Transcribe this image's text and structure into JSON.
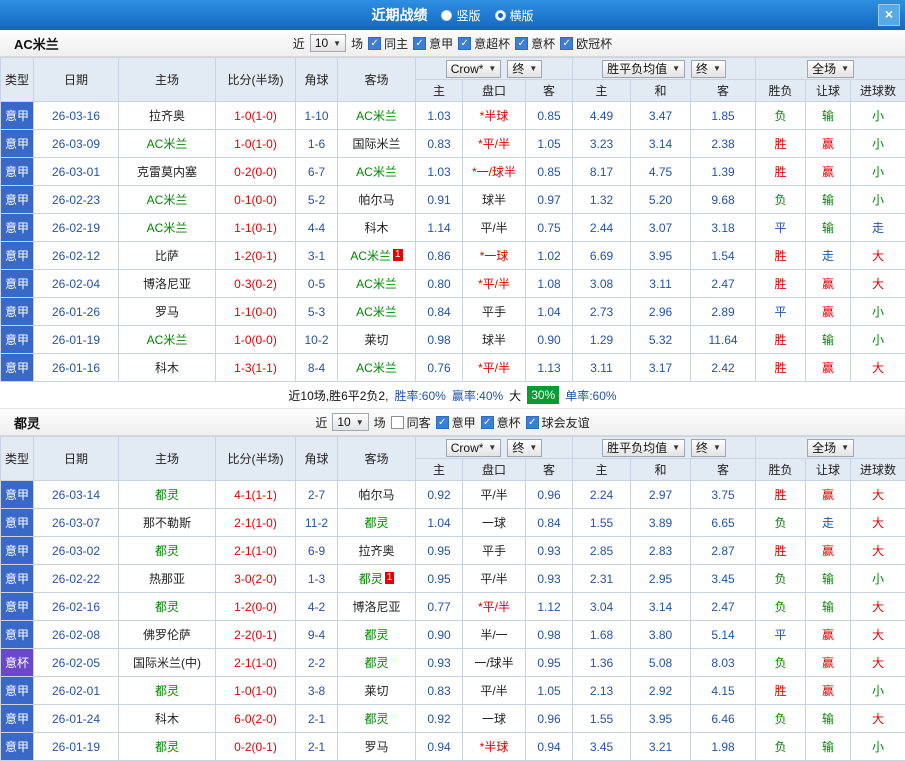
{
  "topbar": {
    "title": "近期战绩",
    "radios": [
      {
        "label": "竖版",
        "selected": false
      },
      {
        "label": "横版",
        "selected": true
      }
    ],
    "close_label": "×"
  },
  "colors": {
    "topbar_blue": "#1268C0",
    "league_type_bg": "#3A68C6",
    "cup_type_bg": "#6A48C8",
    "win_red": "#E60000",
    "lose_green": "#008800",
    "push_blue": "#2353A8",
    "rate_badge_green": "#0B9B33"
  },
  "table_header": {
    "type": "类型",
    "date": "日期",
    "home": "主场",
    "score": "比分(半场)",
    "corner": "角球",
    "away": "客场",
    "bookmaker_dd": "Crow*",
    "final_dd": "终",
    "asia_home": "主",
    "handicap": "盘口",
    "asia_away": "客",
    "eu_dd": "胜平负均值",
    "eu_final_dd": "终",
    "eu_home": "主",
    "eu_draw": "和",
    "eu_away": "客",
    "scope_dd": "全场",
    "result": "胜负",
    "handicap_result": "让球",
    "goals": "进球数"
  },
  "sections": [
    {
      "team": "AC米兰",
      "near_label": "近",
      "near_count": "10",
      "games_label": "场",
      "checkboxes": [
        {
          "label": "同主",
          "checked": true
        },
        {
          "label": "意甲",
          "checked": true
        },
        {
          "label": "意超杯",
          "checked": true
        },
        {
          "label": "意杯",
          "checked": true
        },
        {
          "label": "欧冠杯",
          "checked": true
        }
      ],
      "rows": [
        {
          "type": "意甲",
          "date": "26-03-16",
          "home": "拉齐奥",
          "score": "1-0(1-0)",
          "corner": "1-10",
          "away": "AC米兰",
          "asia_home": "1.03",
          "handicap": "*半球",
          "asia_away": "0.85",
          "eu_home": "4.49",
          "eu_draw": "3.47",
          "eu_away": "1.85",
          "result": "负",
          "handicap_result": "输",
          "goals": "小"
        },
        {
          "type": "意甲",
          "date": "26-03-09",
          "home": "AC米兰",
          "score": "1-0(1-0)",
          "corner": "1-6",
          "away": "国际米兰",
          "asia_home": "0.83",
          "handicap": "*平/半",
          "asia_away": "1.05",
          "eu_home": "3.23",
          "eu_draw": "3.14",
          "eu_away": "2.38",
          "result": "胜",
          "handicap_result": "赢",
          "goals": "小"
        },
        {
          "type": "意甲",
          "date": "26-03-01",
          "home": "克雷莫内塞",
          "score": "0-2(0-0)",
          "corner": "6-7",
          "away": "AC米兰",
          "asia_home": "1.03",
          "handicap": "*一/球半",
          "asia_away": "0.85",
          "eu_home": "8.17",
          "eu_draw": "4.75",
          "eu_away": "1.39",
          "result": "胜",
          "handicap_result": "赢",
          "goals": "小"
        },
        {
          "type": "意甲",
          "date": "26-02-23",
          "home": "AC米兰",
          "score": "0-1(0-0)",
          "corner": "5-2",
          "away": "帕尔马",
          "asia_home": "0.91",
          "handicap": "球半",
          "asia_away": "0.97",
          "eu_home": "1.32",
          "eu_draw": "5.20",
          "eu_away": "9.68",
          "result": "负",
          "handicap_result": "输",
          "goals": "小"
        },
        {
          "type": "意甲",
          "date": "26-02-19",
          "home": "AC米兰",
          "score": "1-1(0-1)",
          "corner": "4-4",
          "away": "科木",
          "asia_home": "1.14",
          "handicap": "平/半",
          "asia_away": "0.75",
          "eu_home": "2.44",
          "eu_draw": "3.07",
          "eu_away": "3.18",
          "result": "平",
          "handicap_result": "输",
          "goals": "走"
        },
        {
          "type": "意甲",
          "date": "26-02-12",
          "home": "比萨",
          "score": "1-2(0-1)",
          "corner": "3-1",
          "away": "AC米兰",
          "away_badge": "1",
          "asia_home": "0.86",
          "handicap": "*一球",
          "asia_away": "1.02",
          "eu_home": "6.69",
          "eu_draw": "3.95",
          "eu_away": "1.54",
          "result": "胜",
          "handicap_result": "走",
          "goals": "大"
        },
        {
          "type": "意甲",
          "date": "26-02-04",
          "home": "博洛尼亚",
          "score": "0-3(0-2)",
          "corner": "0-5",
          "away": "AC米兰",
          "asia_home": "0.80",
          "handicap": "*平/半",
          "asia_away": "1.08",
          "eu_home": "3.08",
          "eu_draw": "3.11",
          "eu_away": "2.47",
          "result": "胜",
          "handicap_result": "赢",
          "goals": "大"
        },
        {
          "type": "意甲",
          "date": "26-01-26",
          "home": "罗马",
          "score": "1-1(0-0)",
          "corner": "5-3",
          "away": "AC米兰",
          "asia_home": "0.84",
          "handicap": "平手",
          "asia_away": "1.04",
          "eu_home": "2.73",
          "eu_draw": "2.96",
          "eu_away": "2.89",
          "result": "平",
          "handicap_result": "赢",
          "goals": "小"
        },
        {
          "type": "意甲",
          "date": "26-01-19",
          "home": "AC米兰",
          "score": "1-0(0-0)",
          "corner": "10-2",
          "away": "莱切",
          "asia_home": "0.98",
          "handicap": "球半",
          "asia_away": "0.90",
          "eu_home": "1.29",
          "eu_draw": "5.32",
          "eu_away": "11.64",
          "result": "胜",
          "handicap_result": "输",
          "goals": "小"
        },
        {
          "type": "意甲",
          "date": "26-01-16",
          "home": "科木",
          "score": "1-3(1-1)",
          "corner": "8-4",
          "away": "AC米兰",
          "asia_home": "0.76",
          "handicap": "*平/半",
          "asia_away": "1.13",
          "eu_home": "3.11",
          "eu_draw": "3.17",
          "eu_away": "2.42",
          "result": "胜",
          "handicap_result": "赢",
          "goals": "大"
        }
      ],
      "summary": {
        "record": "近10场,胜6平2负2,",
        "win_rate": "胜率:60%",
        "cover_rate": "赢率:40%",
        "big_label": "大",
        "big_rate": "30%",
        "odd_rate": "单率:60%"
      }
    },
    {
      "team": "都灵",
      "near_label": "近",
      "near_count": "10",
      "games_label": "场",
      "checkboxes": [
        {
          "label": "同客",
          "checked": false
        },
        {
          "label": "意甲",
          "checked": true
        },
        {
          "label": "意杯",
          "checked": true
        },
        {
          "label": "球会友谊",
          "checked": true
        }
      ],
      "rows": [
        {
          "type": "意甲",
          "date": "26-03-14",
          "home": "都灵",
          "score": "4-1(1-1)",
          "corner": "2-7",
          "away": "帕尔马",
          "asia_home": "0.92",
          "handicap": "平/半",
          "asia_away": "0.96",
          "eu_home": "2.24",
          "eu_draw": "2.97",
          "eu_away": "3.75",
          "result": "胜",
          "handicap_result": "赢",
          "goals": "大"
        },
        {
          "type": "意甲",
          "date": "26-03-07",
          "home": "那不勒斯",
          "score": "2-1(1-0)",
          "corner": "11-2",
          "away": "都灵",
          "asia_home": "1.04",
          "handicap": "一球",
          "asia_away": "0.84",
          "eu_home": "1.55",
          "eu_draw": "3.89",
          "eu_away": "6.65",
          "result": "负",
          "handicap_result": "走",
          "goals": "大"
        },
        {
          "type": "意甲",
          "date": "26-03-02",
          "home": "都灵",
          "score": "2-1(1-0)",
          "corner": "6-9",
          "away": "拉齐奥",
          "asia_home": "0.95",
          "handicap": "平手",
          "asia_away": "0.93",
          "eu_home": "2.85",
          "eu_draw": "2.83",
          "eu_away": "2.87",
          "result": "胜",
          "handicap_result": "赢",
          "goals": "大"
        },
        {
          "type": "意甲",
          "date": "26-02-22",
          "home": "热那亚",
          "score": "3-0(2-0)",
          "corner": "1-3",
          "away": "都灵",
          "away_badge": "1",
          "asia_home": "0.95",
          "handicap": "平/半",
          "asia_away": "0.93",
          "eu_home": "2.31",
          "eu_draw": "2.95",
          "eu_away": "3.45",
          "result": "负",
          "handicap_result": "输",
          "goals": "小"
        },
        {
          "type": "意甲",
          "date": "26-02-16",
          "home": "都灵",
          "score": "1-2(0-0)",
          "corner": "4-2",
          "away": "博洛尼亚",
          "asia_home": "0.77",
          "handicap": "*平/半",
          "asia_away": "1.12",
          "eu_home": "3.04",
          "eu_draw": "3.14",
          "eu_away": "2.47",
          "result": "负",
          "handicap_result": "输",
          "goals": "大"
        },
        {
          "type": "意甲",
          "date": "26-02-08",
          "home": "佛罗伦萨",
          "score": "2-2(0-1)",
          "corner": "9-4",
          "away": "都灵",
          "asia_home": "0.90",
          "handicap": "半/一",
          "asia_away": "0.98",
          "eu_home": "1.68",
          "eu_draw": "3.80",
          "eu_away": "5.14",
          "result": "平",
          "handicap_result": "赢",
          "goals": "大"
        },
        {
          "type": "意杯",
          "date": "26-02-05",
          "home": "国际米兰(中)",
          "score": "2-1(1-0)",
          "corner": "2-2",
          "away": "都灵",
          "asia_home": "0.93",
          "handicap": "一/球半",
          "asia_away": "0.95",
          "eu_home": "1.36",
          "eu_draw": "5.08",
          "eu_away": "8.03",
          "result": "负",
          "handicap_result": "赢",
          "goals": "大"
        },
        {
          "type": "意甲",
          "date": "26-02-01",
          "home": "都灵",
          "score": "1-0(1-0)",
          "corner": "3-8",
          "away": "莱切",
          "asia_home": "0.83",
          "handicap": "平/半",
          "asia_away": "1.05",
          "eu_home": "2.13",
          "eu_draw": "2.92",
          "eu_away": "4.15",
          "result": "胜",
          "handicap_result": "赢",
          "goals": "小"
        },
        {
          "type": "意甲",
          "date": "26-01-24",
          "home": "科木",
          "score": "6-0(2-0)",
          "corner": "2-1",
          "away": "都灵",
          "asia_home": "0.92",
          "handicap": "一球",
          "asia_away": "0.96",
          "eu_home": "1.55",
          "eu_draw": "3.95",
          "eu_away": "6.46",
          "result": "负",
          "handicap_result": "输",
          "goals": "大"
        },
        {
          "type": "意甲",
          "date": "26-01-19",
          "home": "都灵",
          "score": "0-2(0-1)",
          "corner": "2-1",
          "away": "罗马",
          "asia_home": "0.94",
          "handicap": "*半球",
          "asia_away": "0.94",
          "eu_home": "3.45",
          "eu_draw": "3.21",
          "eu_away": "1.98",
          "result": "负",
          "handicap_result": "输",
          "goals": "小"
        }
      ]
    }
  ]
}
